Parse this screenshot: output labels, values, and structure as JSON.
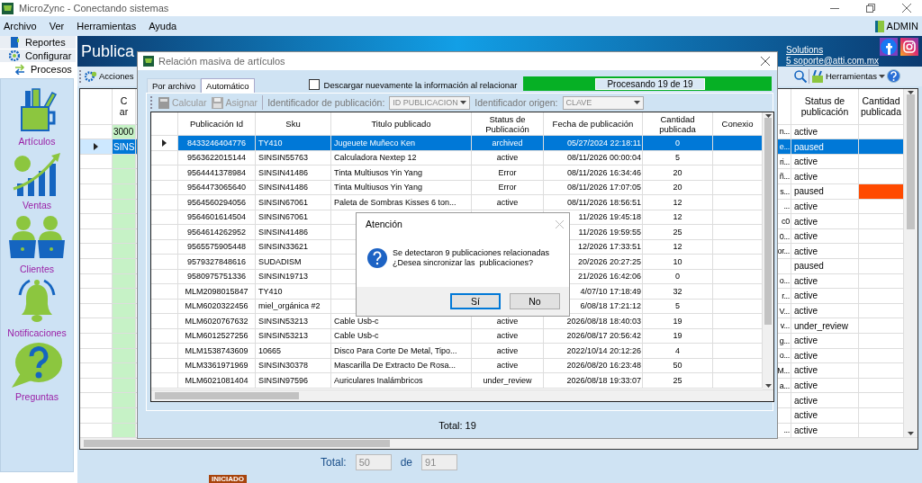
{
  "window": {
    "title": "MicroZync - Conectando sistemas"
  },
  "menu": [
    "Archivo",
    "Ver",
    "Herramientas",
    "Ayuda"
  ],
  "user": "ADMIN",
  "sidebar": {
    "tabs": [
      {
        "label": "Reportes",
        "kind": "reports",
        "selected": false
      },
      {
        "label": "Configurar",
        "kind": "settings",
        "selected": false
      },
      {
        "label": "Procesos",
        "kind": "processes",
        "selected": true
      }
    ],
    "modules": [
      {
        "label": "Artículos",
        "kind": "articles"
      },
      {
        "label": "Ventas",
        "kind": "sales"
      },
      {
        "label": "Clientes",
        "kind": "clients"
      },
      {
        "label": "Notificaciones",
        "kind": "notifications"
      },
      {
        "label": "Preguntas",
        "kind": "questions"
      }
    ]
  },
  "header": {
    "title": "Publica",
    "link": "Solutions",
    "email": "5  soporte@atti.com.mx"
  },
  "toolbar": {
    "actions": "Acciones",
    "tools": "Herramientas"
  },
  "grid": {
    "columns": {
      "column_1": "C\nar",
      "status": "Status de publicación",
      "quantity": "Cantidad publicada"
    },
    "rows": [
      {
        "column_1": "3000",
        "column_3": "n...",
        "status": "active",
        "selected": false
      },
      {
        "column_1": "SINS",
        "column_3": "e...",
        "status": "paused",
        "selected": true
      },
      {
        "column_3": "ri...",
        "status": "active",
        "selected": false
      },
      {
        "column_3": "ñ...",
        "status": "active",
        "selected": false
      },
      {
        "column_3": "s...",
        "status": "paused",
        "selected": false,
        "color": "#ff4a00"
      },
      {
        "column_3": "...",
        "status": "active",
        "selected": false
      },
      {
        "column_3": "c0",
        "status": "active",
        "selected": false
      },
      {
        "column_3": "0...",
        "status": "active",
        "selected": false
      },
      {
        "column_3": "or...",
        "status": "active",
        "selected": false
      },
      {
        "status": "paused",
        "selected": false
      },
      {
        "column_3": "o...",
        "status": "active",
        "selected": false
      },
      {
        "column_3": "r...",
        "status": "active",
        "selected": false
      },
      {
        "column_3": "V...",
        "status": "active",
        "selected": false
      },
      {
        "column_3": "v...",
        "status": "under_review",
        "selected": false
      },
      {
        "column_3": "g...",
        "status": "active",
        "selected": false
      },
      {
        "column_3": "o...",
        "status": "active",
        "selected": false
      },
      {
        "column_3": "M...",
        "status": "active",
        "selected": false
      },
      {
        "column_3": "a...",
        "status": "active",
        "selected": false
      },
      {
        "status": "active",
        "selected": false
      },
      {
        "status": "active",
        "selected": false
      },
      {
        "column_3": "...",
        "status": "active",
        "selected": false
      }
    ]
  },
  "totals": {
    "label": "Total:",
    "shown": "50",
    "of": "de",
    "total": "91"
  },
  "status_bar": {
    "badge": "INICIADO"
  },
  "dialog": {
    "title": "Relación masiva de artículos",
    "tabs": [
      {
        "label": "Por archivo",
        "selected": false
      },
      {
        "label": "Automático",
        "selected": true
      }
    ],
    "redownload": {
      "label": "Descargar nuevamente la información al relacionar",
      "checked": false
    },
    "progress": {
      "label": "Procesando 19 de 19",
      "level": 1
    },
    "buttons": [
      {
        "label": "Calcular",
        "kind": "calculator",
        "disabled": true
      },
      {
        "label": "Asignar",
        "kind": "disk",
        "disabled": true
      }
    ],
    "publication_id": {
      "label": "Identificador de publicación:",
      "value": "ID PUBLICACION"
    },
    "origin_id": {
      "label": "Identificador origen:",
      "value": "CLAVE"
    },
    "table": {
      "columns": [
        "Publicación Id",
        "Sku",
        "Titulo publicado",
        "Status de Publicación",
        "Fecha de publicación",
        "Cantidad publicada",
        "Conexio"
      ],
      "rows": [
        {
          "id": "8433246404776",
          "sku": "TY410",
          "title": "Jugeuete Muñeco Ken",
          "status": "archived",
          "date": "05/27/2024 22:18:11",
          "quantity": "0",
          "selected": true
        },
        {
          "id": "9563622015144",
          "sku": "SINSIN55763",
          "title": "Calculadora Nextep 12",
          "status": "active",
          "date": "08/11/2026 00:00:04",
          "quantity": "5",
          "selected": false
        },
        {
          "id": "9564441378984",
          "sku": "SINSIN41486",
          "title": "Tinta Multiusos Yin Yang",
          "status": "Error",
          "date": "08/11/2026 16:34:46",
          "quantity": "20",
          "selected": false
        },
        {
          "id": "9564473065640",
          "sku": "SINSIN41486",
          "title": "Tinta Multiusos Yin Yang",
          "status": "Error",
          "date": "08/11/2026 17:07:05",
          "quantity": "20",
          "selected": false
        },
        {
          "id": "9564560294056",
          "sku": "SINSIN67061",
          "title": "Paleta de Sombras Kisses 6 ton...",
          "status": "active",
          "date": "08/11/2026 18:56:51",
          "quantity": "12",
          "selected": false
        },
        {
          "id": "9564601614504",
          "sku": "SINSIN67061",
          "date": "11/2026 19:45:18",
          "quantity": "12",
          "selected": false
        },
        {
          "id": "9564614262952",
          "sku": "SINSIN41486",
          "date": "11/2026 19:59:55",
          "quantity": "25",
          "selected": false
        },
        {
          "id": "9565575905448",
          "sku": "SINSIN33621",
          "date": "12/2026 17:33:51",
          "quantity": "12",
          "selected": false
        },
        {
          "id": "9579327848616",
          "sku": "SUDADISM",
          "date": "20/2026 20:27:25",
          "quantity": "10",
          "selected": false
        },
        {
          "id": "9580975751336",
          "sku": "SINSIN19713",
          "date": "21/2026 16:42:06",
          "quantity": "0",
          "selected": false
        },
        {
          "id": "MLM2098015847",
          "sku": "TY410",
          "date": "4/07/10 17:18:49",
          "quantity": "32",
          "selected": false
        },
        {
          "id": "MLM6020322456",
          "sku": "miel_orgánica #2",
          "date": "6/08/18 17:21:12",
          "quantity": "5",
          "selected": false
        },
        {
          "id": "MLM6020767632",
          "sku": "SINSIN53213",
          "title": "Cable Usb-c",
          "status": "active",
          "date": "2026/08/18 18:40:03",
          "quantity": "19",
          "selected": false
        },
        {
          "id": "MLM6012527256",
          "sku": "SINSIN53213",
          "title": "Cable Usb-c",
          "status": "active",
          "date": "2026/08/17 20:56:42",
          "quantity": "19",
          "selected": false
        },
        {
          "id": "MLM1538743609",
          "sku": "10665",
          "title": "Disco Para Corte De Metal, Tipo...",
          "status": "active",
          "date": "2022/10/14 20:12:26",
          "quantity": "4",
          "selected": false
        },
        {
          "id": "MLM3361971969",
          "sku": "SINSIN30378",
          "title": "Mascarilla De Extracto De Rosa...",
          "status": "active",
          "date": "2026/08/20 16:23:48",
          "quantity": "50",
          "selected": false
        },
        {
          "id": "MLM6021081404",
          "sku": "SINSIN97596",
          "title": "Auriculares Inalámbricos",
          "status": "under_review",
          "date": "2026/08/18 19:33:07",
          "quantity": "25",
          "selected": false
        }
      ]
    },
    "total": "Total: 19"
  },
  "alert": {
    "title": "Atención",
    "message": "Se detectaron 9 publicaciones relacionadas\n¿Desea sincronizar las  publicaciones?",
    "buttons": [
      {
        "label": "Sí",
        "selected": true
      },
      {
        "label": "No",
        "selected": false
      }
    ]
  }
}
